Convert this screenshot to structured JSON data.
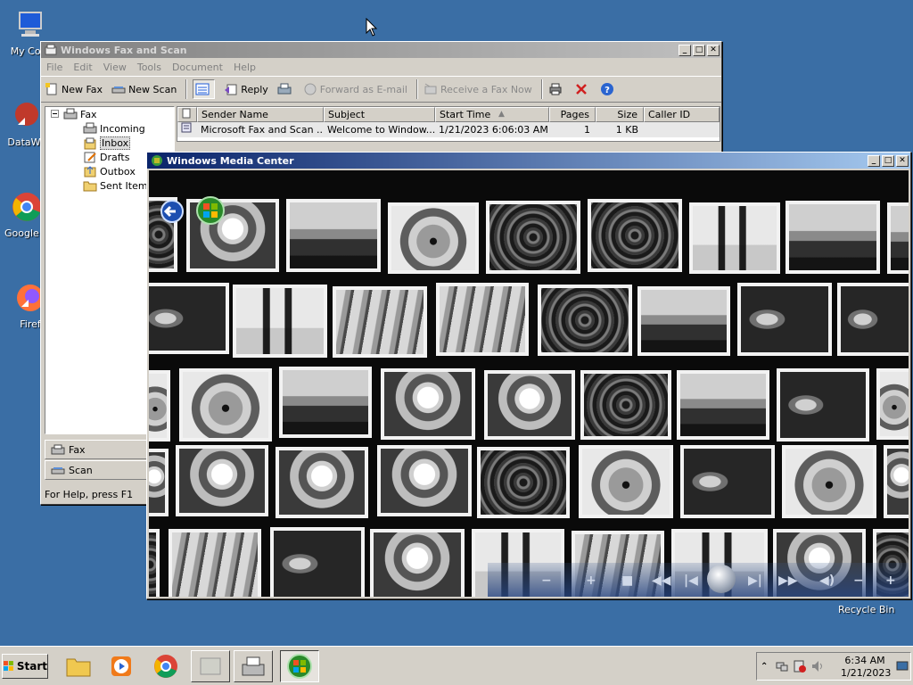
{
  "desktop": {
    "icons": [
      {
        "label": "My Com"
      },
      {
        "label": "DataWa"
      },
      {
        "label": "Google C"
      },
      {
        "label": "Firef"
      }
    ],
    "recycle_bin": "Recycle Bin"
  },
  "fax_window": {
    "title": "Windows Fax and Scan",
    "menu": [
      "File",
      "Edit",
      "View",
      "Tools",
      "Document",
      "Help"
    ],
    "toolbar": {
      "new_fax": "New Fax",
      "new_scan": "New Scan",
      "reply": "Reply",
      "forward_email": "Forward as E-mail",
      "receive_fax": "Receive a Fax Now"
    },
    "tree": {
      "root": "Fax",
      "folders": [
        "Incoming",
        "Inbox",
        "Drafts",
        "Outbox",
        "Sent Items"
      ],
      "selected": "Inbox"
    },
    "columns": [
      "Sender Name",
      "Subject",
      "Start Time",
      "Pages",
      "Size",
      "Caller ID"
    ],
    "rows": [
      {
        "sender": "Microsoft Fax and Scan ...",
        "subject": "Welcome to Window...",
        "start_time": "1/21/2023 6:06:03 AM",
        "pages": "1",
        "size": "1 KB",
        "caller_id": ""
      }
    ],
    "nav": {
      "fax": "Fax",
      "scan": "Scan"
    },
    "status": "For Help, press F1"
  },
  "wmc_window": {
    "title": "Windows Media Center"
  },
  "taskbar": {
    "start": "Start",
    "time": "6:34 AM",
    "date": "1/21/2023"
  }
}
